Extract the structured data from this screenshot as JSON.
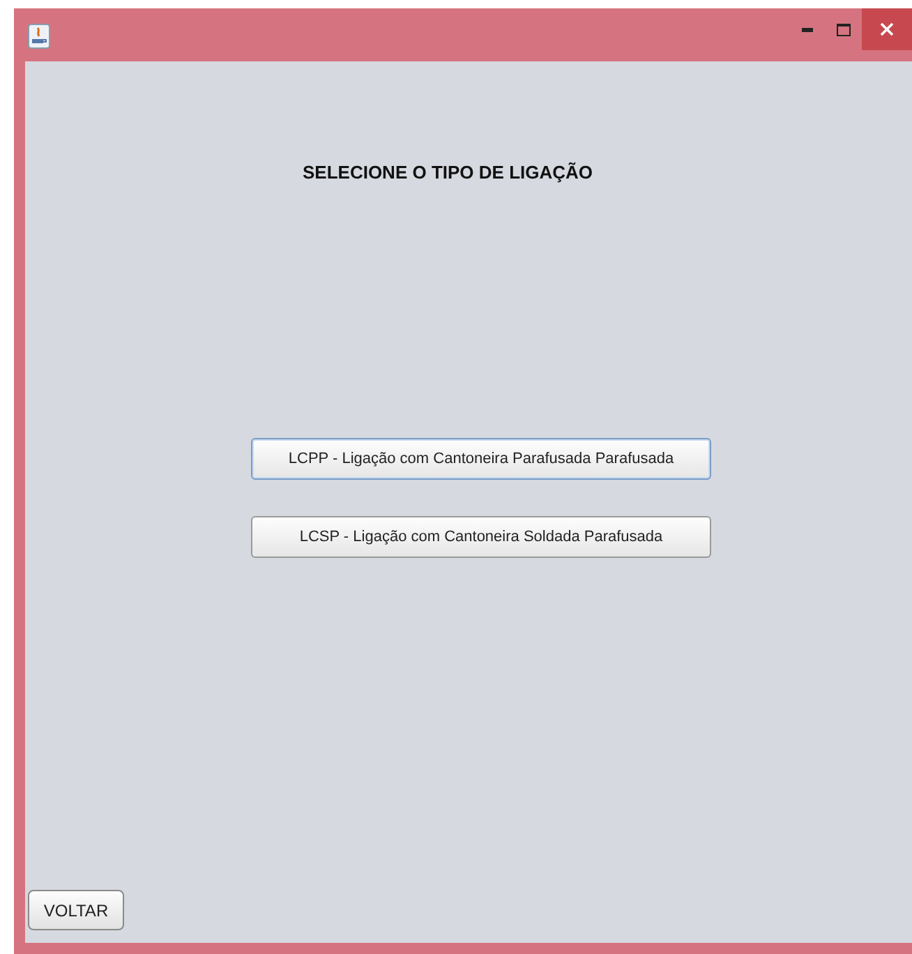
{
  "heading": "SELECIONE O TIPO DE LIGAÇÃO",
  "options": [
    {
      "label": "LCPP - Ligação com Cantoneira Parafusada Parafusada",
      "focused": true
    },
    {
      "label": "LCSP - Ligação com Cantoneira Soldada Parafusada",
      "focused": false
    }
  ],
  "back_button": "VOLTAR"
}
